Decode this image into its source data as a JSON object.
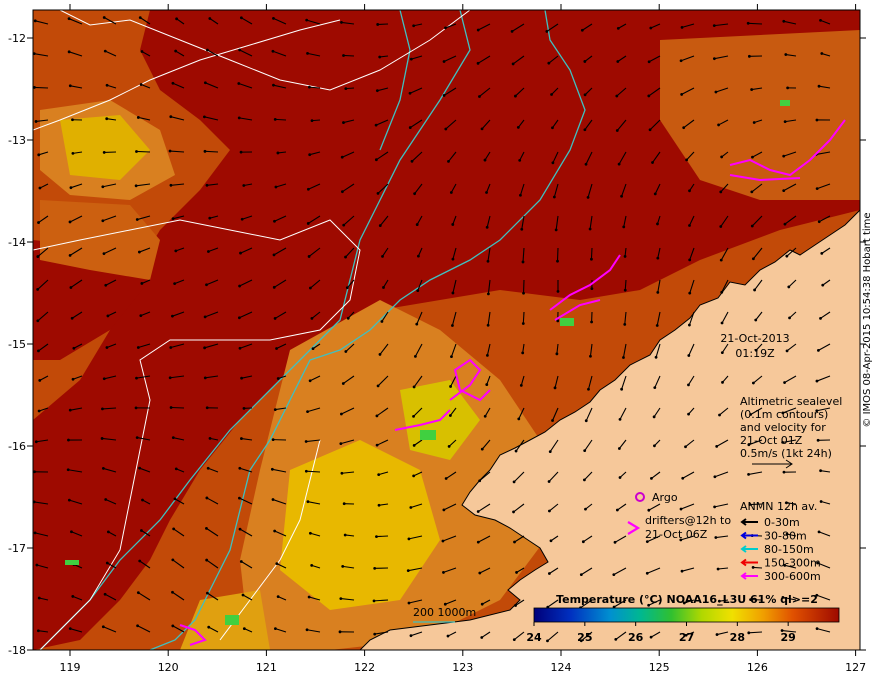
{
  "map": {
    "date_label": "21-Oct-2013",
    "time_label": "01:19Z",
    "lon_ticks": [
      "119",
      "120",
      "121",
      "122",
      "123",
      "124",
      "125",
      "126",
      "127"
    ],
    "lat_ticks": [
      "-12",
      "-13",
      "-14",
      "-15",
      "-16",
      "-17",
      "-18"
    ],
    "altimetry_note": [
      "Altimetric sealevel",
      "(0.1m contours)",
      "and velocity for",
      "21-Oct 01Z",
      "0.5m/s (1kt 24h)"
    ],
    "argo_label": "Argo",
    "drifters_label": [
      "drifters@12h to",
      "21-Oct 06Z"
    ],
    "anmn_title": "ANMN 12h av.",
    "anmn_depths": [
      {
        "label": "0-30m",
        "color": "#000000"
      },
      {
        "label": "30-80m",
        "color": "#0000dd"
      },
      {
        "label": "80-150m",
        "color": "#00cccc"
      },
      {
        "label": "150-300m",
        "color": "#ee0000"
      },
      {
        "label": "300-600m",
        "color": "#ff00ff"
      }
    ],
    "isobath_label": "200  1000m",
    "colorbar": {
      "title": "Temperature (°C) NOAA16_L3U 61% ql>=2",
      "ticks": [
        "24",
        "25",
        "26",
        "27",
        "28",
        "29"
      ],
      "min": 24,
      "max": 30
    },
    "credit": "© IMOS 08-Apr-2015 10:54:38 Hobart time",
    "colors": {
      "sea_hot": "#9e0a00",
      "sea_warm": "#c83c00",
      "sea_mid": "#d97010",
      "land": "#f6c89a",
      "argo": "#cc00cc",
      "drifter": "#ff00ff",
      "isobath": "#40c0c0"
    }
  }
}
